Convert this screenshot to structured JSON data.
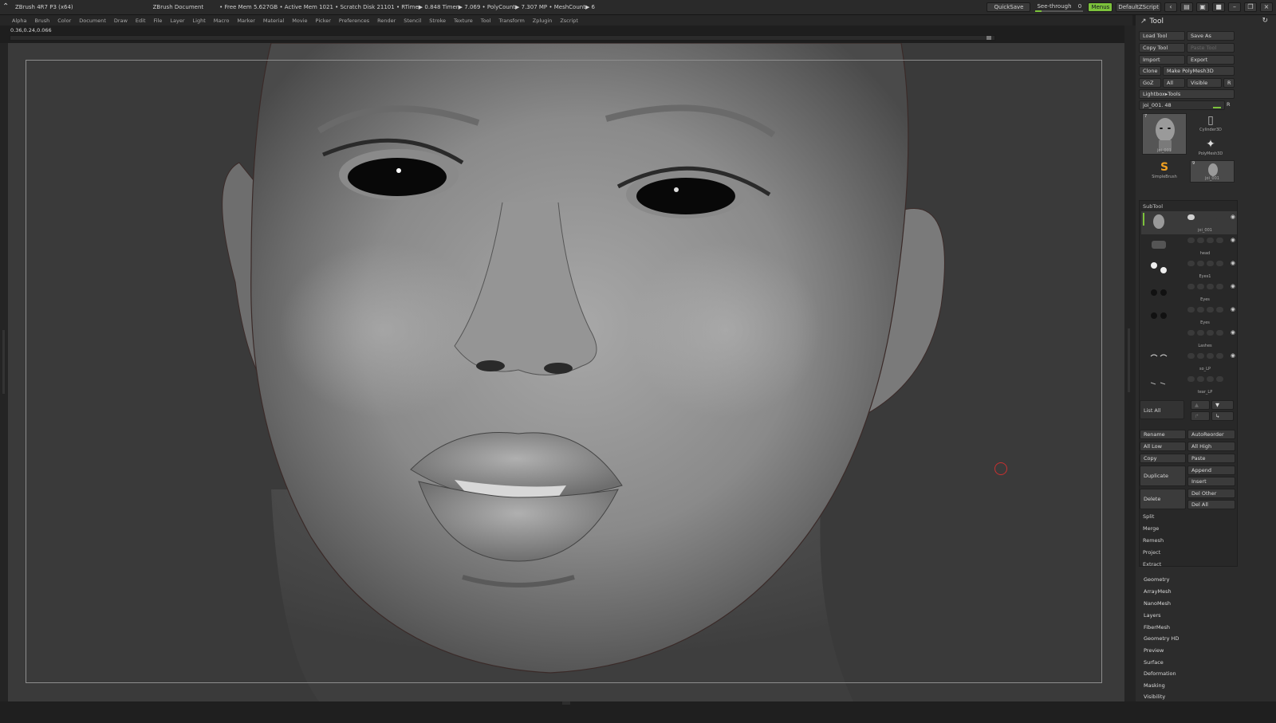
{
  "titlebar": {
    "app": "ZBrush 4R7 P3 (x64)",
    "document": "ZBrush Document",
    "stats": "• Free Mem 5.627GB • Active Mem 1021 • Scratch Disk 21101 • RTime▶ 0.848 Timer▶ 7.069 • PolyCount▶ 7.307 MP • MeshCount▶ 6",
    "quicksave": "QuickSave",
    "see_through": "See-through",
    "see_through_value": "0",
    "menus_label": "Menus",
    "zscript": "DefaultZScript"
  },
  "menubar": [
    "Alpha",
    "Brush",
    "Color",
    "Document",
    "Draw",
    "Edit",
    "File",
    "Layer",
    "Light",
    "Macro",
    "Marker",
    "Material",
    "Movie",
    "Picker",
    "Preferences",
    "Render",
    "Stencil",
    "Stroke",
    "Texture",
    "Tool",
    "Transform",
    "Zplugin",
    "Zscript"
  ],
  "coords": "0.36,0.24,0.066",
  "panel": {
    "title": "Tool",
    "load_tool": "Load Tool",
    "save_as": "Save As",
    "copy_tool": "Copy Tool",
    "paste_tool": "Paste Tool",
    "import": "Import",
    "export": "Export",
    "clone": "Clone",
    "make_polymesh": "Make PolyMesh3D",
    "goz": "GoZ",
    "all": "All",
    "visible": "Visible",
    "r": "R",
    "lightbox_tools": "Lightbox▸Tools",
    "current_tool": "joi_001. 48",
    "tool_thumbs": [
      {
        "name": "joi_001",
        "count": "7"
      },
      {
        "name": "Cylinder3D"
      },
      {
        "name": "PolyMesh3D"
      },
      {
        "name": "SimpleBrush"
      },
      {
        "name": "joi_001",
        "count": "9"
      }
    ],
    "subtool_title": "SubTool",
    "subtools": [
      "joi_001",
      "head",
      "Eyes1",
      "Eyes",
      "Eyes",
      "Lashes",
      "so_LP",
      "tear_LP"
    ],
    "list_all": "List All",
    "rename": "Rename",
    "autoreorder": "AutoReorder",
    "all_low": "All Low",
    "all_high": "All High",
    "copy": "Copy",
    "paste": "Paste",
    "duplicate": "Duplicate",
    "append": "Append",
    "insert": "Insert",
    "delete": "Delete",
    "del_other": "Del Other",
    "del_all": "Del All",
    "split": "Split",
    "merge": "Merge",
    "remesh": "Remesh",
    "project": "Project",
    "extract": "Extract",
    "sections": [
      "Geometry",
      "ArrayMesh",
      "NanoMesh",
      "Layers",
      "FiberMesh",
      "Geometry HD",
      "Preview",
      "Surface",
      "Deformation",
      "Masking",
      "Visibility"
    ]
  }
}
